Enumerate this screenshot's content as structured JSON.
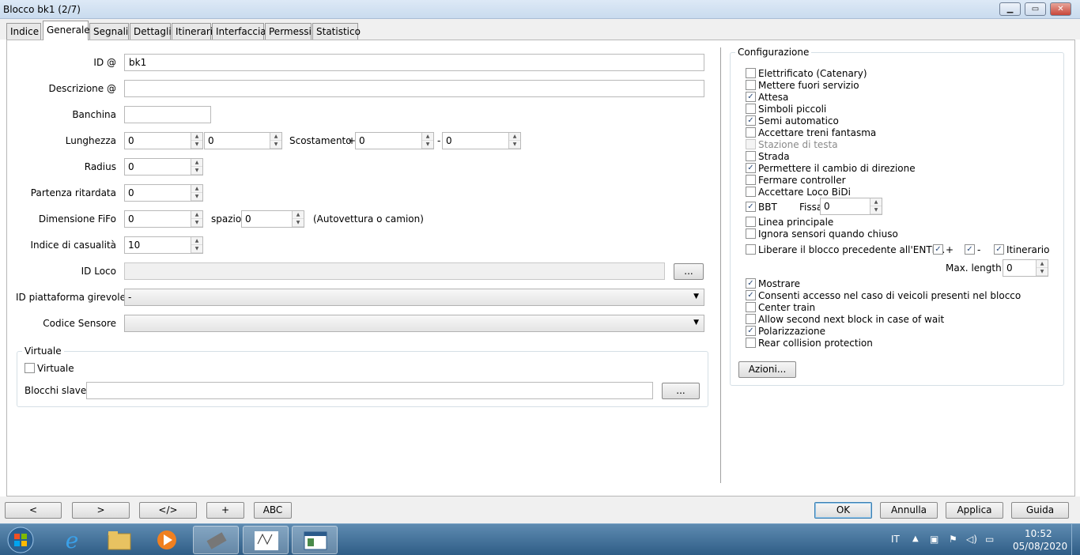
{
  "window": {
    "title": "Blocco bk1 (2/7)",
    "btn_min": "▁",
    "btn_max": "▭",
    "btn_close": "✕"
  },
  "tabs": [
    "Indice",
    "Generale",
    "Segnali",
    "Dettagli",
    "Itinerari",
    "Interfaccia",
    "Permessi",
    "Statistico"
  ],
  "active_tab": "Generale",
  "form": {
    "id_label": "ID @",
    "id_value": "bk1",
    "descrizione_label": "Descrizione @",
    "descrizione_value": "",
    "banchina_label": "Banchina",
    "banchina_value": "",
    "lunghezza_label": "Lunghezza",
    "lunghezza_value1": "0",
    "lunghezza_value2": "0",
    "scostamento_label": "Scostamento",
    "scostamento_plus": "+",
    "scostamento_plus_value": "0",
    "scostamento_minus": "-",
    "scostamento_minus_value": "0",
    "radius_label": "Radius",
    "radius_value": "0",
    "partenza_label": "Partenza ritardata",
    "partenza_value": "0",
    "fifo_label": "Dimensione FiFo",
    "fifo_value": "0",
    "spazio_label": "spazio",
    "spazio_value": "0",
    "spazio_note": "(Autovettura o camion)",
    "casualita_label": "Indice di casualità",
    "casualita_value": "10",
    "idloco_label": "ID Loco",
    "idloco_value": "",
    "idloco_button": "...",
    "piattaforma_label": "ID piattaforma girevole",
    "piattaforma_value": "-",
    "sensore_label": "Codice Sensore",
    "sensore_value": "",
    "virtuale_group": "Virtuale",
    "virtuale_checkbox": "Virtuale",
    "virtuale_checked": false,
    "slave_label": "Blocchi slave",
    "slave_value": "",
    "slave_button": "..."
  },
  "config": {
    "title": "Configurazione",
    "options": [
      {
        "label": "Elettrificato (Catenary)",
        "checked": false,
        "disabled": false
      },
      {
        "label": "Mettere fuori servizio",
        "checked": false,
        "disabled": false
      },
      {
        "label": "Attesa",
        "checked": true,
        "disabled": false
      },
      {
        "label": "Simboli piccoli",
        "checked": false,
        "disabled": false
      },
      {
        "label": "Semi automatico",
        "checked": true,
        "disabled": false
      },
      {
        "label": "Accettare treni fantasma",
        "checked": false,
        "disabled": false
      },
      {
        "label": "Stazione di testa",
        "checked": false,
        "disabled": true
      },
      {
        "label": "Strada",
        "checked": false,
        "disabled": false
      },
      {
        "label": "Permettere il cambio di direzione",
        "checked": true,
        "disabled": false
      },
      {
        "label": "Fermare controller",
        "checked": false,
        "disabled": false
      },
      {
        "label": "Accettare Loco BiDi",
        "checked": false,
        "disabled": false
      }
    ],
    "bbt_label": "BBT",
    "bbt_checked": true,
    "fissa_label": "Fissa",
    "fissa_value": "0",
    "options2": [
      {
        "label": "Linea principale",
        "checked": false
      },
      {
        "label": "Ignora sensori quando chiuso",
        "checked": false
      }
    ],
    "liberare_label": "Liberare il blocco precedente all'ENTER",
    "liberare_checked": false,
    "plus_label": "+",
    "plus_checked": true,
    "minus_label": "-",
    "minus_checked": true,
    "itinerario_label": "Itinerario",
    "itinerario_checked": true,
    "maxlen_label": "Max. length",
    "maxlen_value": "0",
    "options3": [
      {
        "label": "Mostrare",
        "checked": true
      },
      {
        "label": "Consenti accesso nel caso di veicoli presenti nel blocco",
        "checked": true
      },
      {
        "label": "Center train",
        "checked": false
      },
      {
        "label": "Allow second next block in case of wait",
        "checked": false
      },
      {
        "label": "Polarizzazione",
        "checked": true
      },
      {
        "label": "Rear collision protection",
        "checked": false
      }
    ],
    "azioni_button": "Azioni..."
  },
  "bottom": {
    "nav": [
      "<",
      ">",
      "</>",
      "+",
      "ABC"
    ],
    "ok": "OK",
    "annulla": "Annulla",
    "applica": "Applica",
    "guida": "Guida"
  },
  "taskbar": {
    "lang": "IT",
    "time": "10:52",
    "date": "05/08/2020",
    "tray_icons": [
      "expand-tray-icon",
      "network-icon",
      "flag-icon",
      "volume-icon",
      "power-icon"
    ]
  }
}
